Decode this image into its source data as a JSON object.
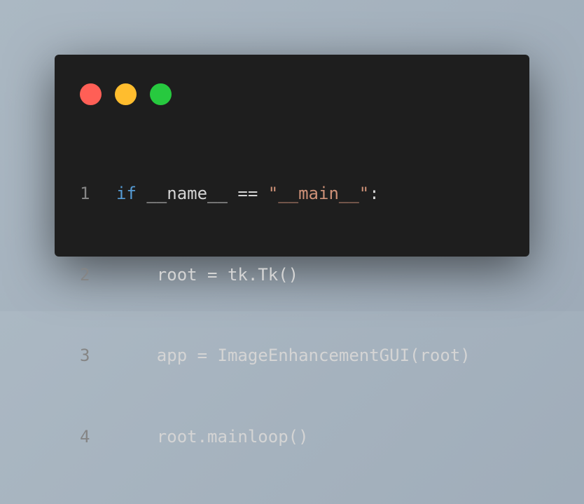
{
  "window_controls": {
    "close_color": "#ff5f56",
    "minimize_color": "#ffbd2e",
    "maximize_color": "#27c93f"
  },
  "code": {
    "language": "python",
    "lines": [
      {
        "number": "1",
        "keyword": "if",
        "text": " __name__ == ",
        "string": "\"__main__\"",
        "tail": ":"
      },
      {
        "number": "2",
        "text": "    root = tk.Tk()"
      },
      {
        "number": "3",
        "text": "    app = ImageEnhancementGUI(root)"
      },
      {
        "number": "4",
        "text": "    root.mainloop()"
      }
    ]
  }
}
